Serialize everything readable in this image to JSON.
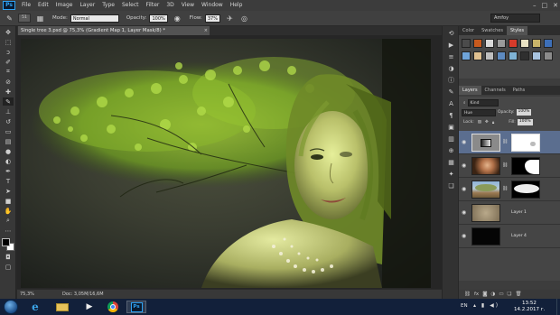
{
  "app": {
    "logo": "Ps"
  },
  "menu": [
    "File",
    "Edit",
    "Image",
    "Layer",
    "Type",
    "Select",
    "Filter",
    "3D",
    "View",
    "Window",
    "Help"
  ],
  "window_controls": [
    "–",
    "□",
    "✕"
  ],
  "options_bar": {
    "brush_size": "51",
    "mode_label": "Mode:",
    "mode_value": "Normal",
    "opacity_label": "Opacity:",
    "opacity_value": "100%",
    "flow_label": "Flow:",
    "flow_value": "37%",
    "workspace": "Amfoy"
  },
  "document": {
    "tab_title": "Single tree 3.psd @ 75,3% (Gradient Map 1, Layer Mask/8) *",
    "close": "×",
    "zoom": "75,3%",
    "doc_size": "Doc: 3,05M/16,6M"
  },
  "panels": {
    "top_tabs": [
      "Color",
      "Swatches",
      "Styles"
    ],
    "top_active": "Styles",
    "layer_tabs": [
      "Layers",
      "Channels",
      "Paths"
    ],
    "layer_active": "Layers",
    "kind_label": "Kind",
    "blend_mode": "Hue",
    "opacity_label": "Opacity:",
    "opacity_value": "100%",
    "lock_label": "Lock:",
    "fill_label": "Fill:",
    "fill_value": "100%",
    "layers": [
      {
        "name": "",
        "type": "adjustment",
        "selected": true
      },
      {
        "name": "",
        "type": "woman",
        "selected": false
      },
      {
        "name": "",
        "type": "tree",
        "selected": false
      },
      {
        "name": "Layer 1",
        "type": "texture",
        "selected": false
      },
      {
        "name": "Layer 4",
        "type": "black",
        "selected": false
      }
    ],
    "footer_icons": [
      "link-icon",
      "fx-icon",
      "mask-icon",
      "adjustment-icon",
      "folder-icon",
      "new-layer-icon",
      "trash-icon"
    ]
  },
  "taskbar": {
    "language": "EN",
    "time": "13:52",
    "date": "14.2.2017 г."
  }
}
